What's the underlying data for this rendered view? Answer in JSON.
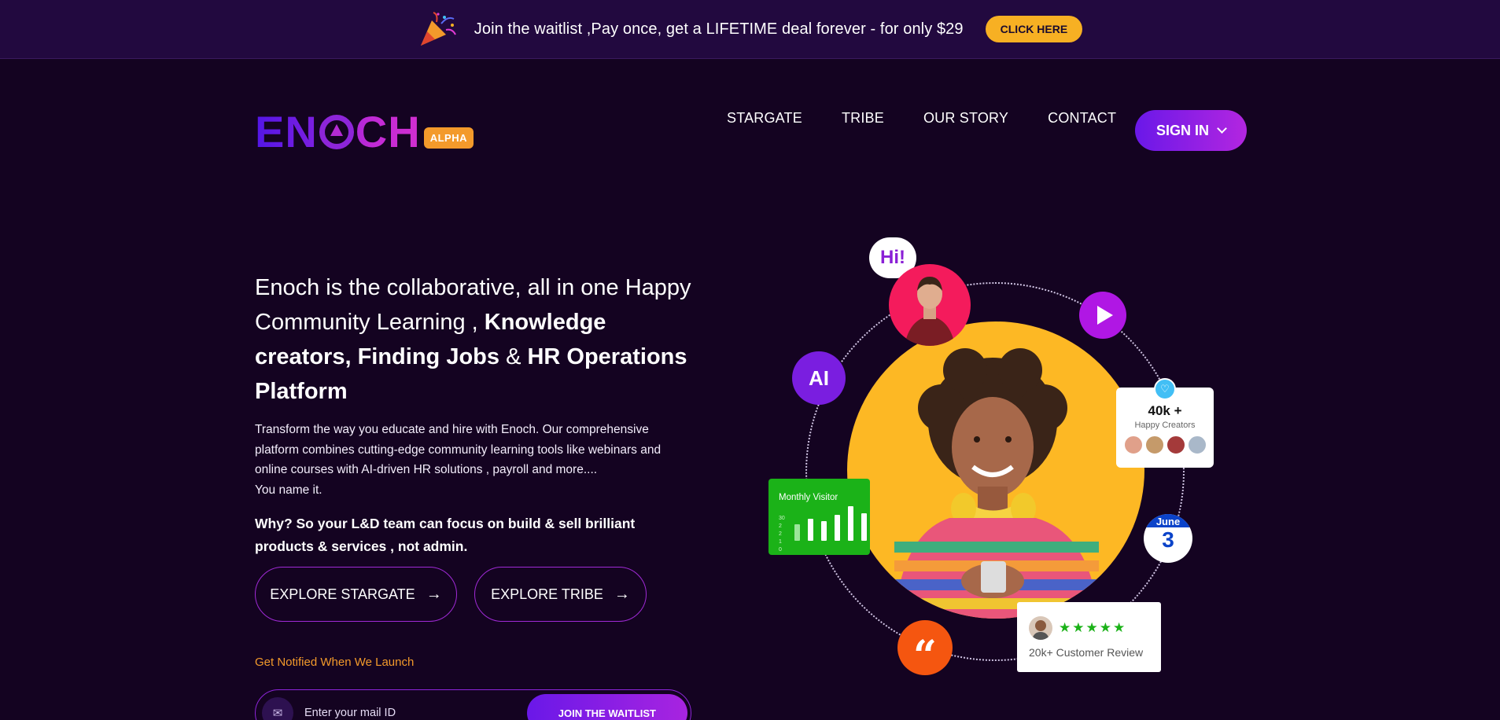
{
  "banner": {
    "icon": "party-popper-icon",
    "text": "Join the waitlist ,Pay once, get a LIFETIME deal forever - for only $29",
    "button": "CLICK HERE"
  },
  "header": {
    "logo_text_left": "EN",
    "logo_text_right": "CH",
    "badge": "ALPHA",
    "nav": [
      "STARGATE",
      "TRIBE",
      "OUR STORY",
      "CONTACT"
    ],
    "signin": "SIGN IN"
  },
  "hero": {
    "headline_plain": "Enoch is the collaborative, all in one Happy Community Learning ,",
    "headline_bold_1": "Knowledge creators, Finding Jobs",
    "headline_amp": "&",
    "headline_bold_2": "HR Operations Platform",
    "description": "Transform the way you educate and hire with Enoch. Our comprehensive platform combines cutting-edge community learning tools like webinars and online courses with AI-driven HR solutions , payroll and more....",
    "description_tail": "You name it.",
    "why": "Why? So your L&D team can focus on build & sell brilliant products & services , not admin.",
    "explore_stargate": "EXPLORE STARGATE",
    "explore_tribe": "EXPLORE TRIBE",
    "notify": "Get Notified When We Launch",
    "email_placeholder": "Enter your mail ID",
    "join_button": "JOIN THE WAITLIST"
  },
  "visual": {
    "hi": "Hi!",
    "ai_label": "AI",
    "creators_count": "40k +",
    "creators_label": "Happy Creators",
    "visitor_title": "Monthly Visitor",
    "visitor_axis": [
      "30",
      "2",
      "2",
      "1",
      "0"
    ],
    "visitor_levels": [
      0.45,
      0.6,
      0.55,
      0.72,
      0.95,
      0.75
    ],
    "date_month": "June",
    "date_day": "3",
    "review_stars": "★★★★★",
    "review_text": "20k+ Customer Review"
  },
  "colors": {
    "background": "#140321",
    "banner": "#22093f",
    "accent_orange": "#f39a2b",
    "accent_purple": "#8d25d9",
    "sun_yellow": "#fdb824"
  }
}
